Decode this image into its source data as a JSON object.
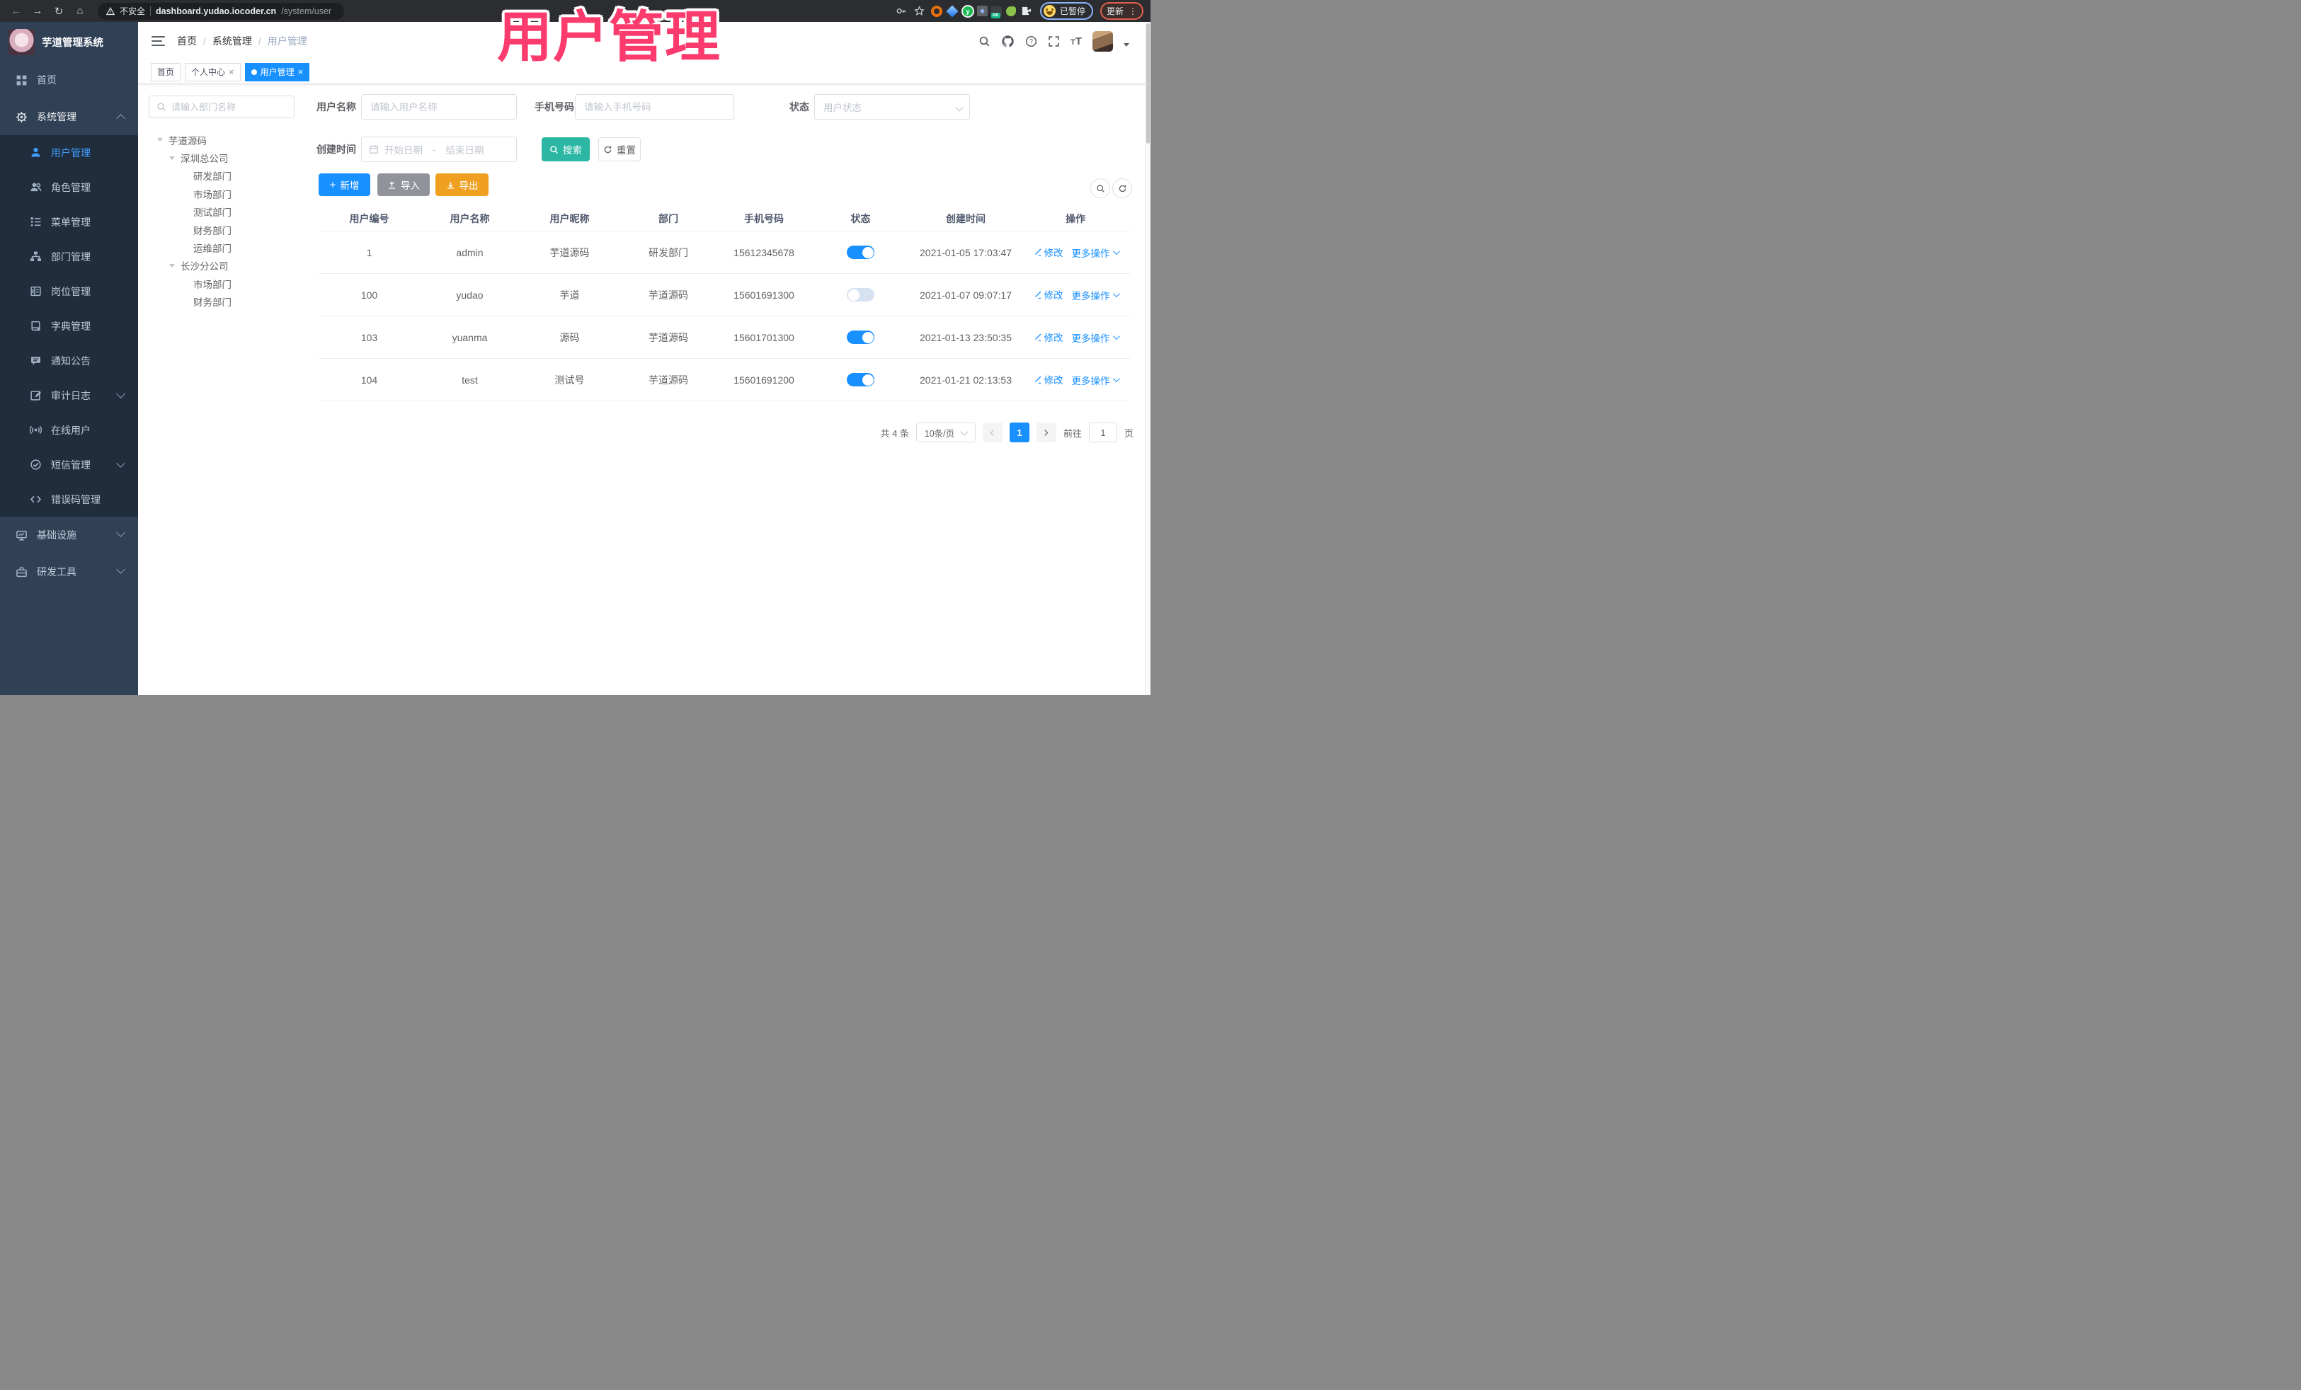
{
  "colors": {
    "primary": "#1890ff",
    "sidebar_active": "#409EFF",
    "search_teal": "#2bb7a3",
    "export_orange": "#f0a020",
    "import_gray": "#909399",
    "annotation_pink": "#fb3a6d",
    "sidebar_bg": "#304156",
    "submenu_bg": "#1f2d3d"
  },
  "browser": {
    "security_label": "不安全",
    "url_domain": "dashboard.yudao.iocoder.cn",
    "url_path": "/system/user",
    "paused_badge": "已暂停",
    "update_label": "更新"
  },
  "annotation": {
    "text": "用户管理"
  },
  "sidebar": {
    "title": "芋道管理系统",
    "items": [
      {
        "label": "首页",
        "icon": "dashboard-icon",
        "level": "top"
      },
      {
        "label": "系统管理",
        "icon": "gear-icon",
        "level": "top",
        "caret": "up",
        "open": true
      },
      {
        "label": "用户管理",
        "icon": "user-icon",
        "level": "sub",
        "active": true
      },
      {
        "label": "角色管理",
        "icon": "role-icon",
        "level": "sub"
      },
      {
        "label": "菜单管理",
        "icon": "menu-tree-icon",
        "level": "sub"
      },
      {
        "label": "部门管理",
        "icon": "dept-tree-icon",
        "level": "sub"
      },
      {
        "label": "岗位管理",
        "icon": "post-icon",
        "level": "sub"
      },
      {
        "label": "字典管理",
        "icon": "dict-icon",
        "level": "sub"
      },
      {
        "label": "通知公告",
        "icon": "notice-icon",
        "level": "sub"
      },
      {
        "label": "审计日志",
        "icon": "audit-icon",
        "level": "sub",
        "caret": "down"
      },
      {
        "label": "在线用户",
        "icon": "online-icon",
        "level": "sub"
      },
      {
        "label": "短信管理",
        "icon": "sms-icon",
        "level": "sub",
        "caret": "down"
      },
      {
        "label": "错误码管理",
        "icon": "errcode-icon",
        "level": "sub"
      },
      {
        "label": "基础设施",
        "icon": "infra-icon",
        "level": "top",
        "caret": "down"
      },
      {
        "label": "研发工具",
        "icon": "devtools-icon",
        "level": "top",
        "caret": "down"
      }
    ]
  },
  "header": {
    "breadcrumb": [
      "首页",
      "系统管理",
      "用户管理"
    ]
  },
  "tabs": [
    {
      "label": "首页",
      "closable": false,
      "active": false
    },
    {
      "label": "个人中心",
      "closable": true,
      "active": false
    },
    {
      "label": "用户管理",
      "closable": true,
      "active": true
    }
  ],
  "dept_panel": {
    "search_placeholder": "请输入部门名称",
    "tree": [
      {
        "label": "芋道源码",
        "level": 0,
        "expandable": true
      },
      {
        "label": "深圳总公司",
        "level": 1,
        "expandable": true
      },
      {
        "label": "研发部门",
        "level": 2,
        "expandable": false
      },
      {
        "label": "市场部门",
        "level": 2,
        "expandable": false
      },
      {
        "label": "测试部门",
        "level": 2,
        "expandable": false
      },
      {
        "label": "财务部门",
        "level": 2,
        "expandable": false
      },
      {
        "label": "运维部门",
        "level": 2,
        "expandable": false
      },
      {
        "label": "长沙分公司",
        "level": 1,
        "expandable": true
      },
      {
        "label": "市场部门",
        "level": 2,
        "expandable": false
      },
      {
        "label": "财务部门",
        "level": 2,
        "expandable": false
      }
    ]
  },
  "filters": {
    "username_label": "用户名称",
    "username_placeholder": "请输入用户名称",
    "mobile_label": "手机号码",
    "mobile_placeholder": "请输入手机号码",
    "status_label": "状态",
    "status_placeholder": "用户状态",
    "created_label": "创建时间",
    "date_start_placeholder": "开始日期",
    "date_separator": "-",
    "date_end_placeholder": "结束日期",
    "search_button": "搜索",
    "reset_button": "重置"
  },
  "toolbar": {
    "add_button": "新增",
    "import_button": "导入",
    "export_button": "导出"
  },
  "table": {
    "columns": [
      "用户编号",
      "用户名称",
      "用户昵称",
      "部门",
      "手机号码",
      "状态",
      "创建时间",
      "操作"
    ],
    "row_actions": {
      "edit": "修改",
      "more": "更多操作"
    },
    "rows": [
      {
        "id": "1",
        "username": "admin",
        "nickname": "芋道源码",
        "dept": "研发部门",
        "mobile": "15612345678",
        "status_on": true,
        "created": "2021-01-05 17:03:47"
      },
      {
        "id": "100",
        "username": "yudao",
        "nickname": "芋道",
        "dept": "芋道源码",
        "mobile": "15601691300",
        "status_on": false,
        "created": "2021-01-07 09:07:17"
      },
      {
        "id": "103",
        "username": "yuanma",
        "nickname": "源码",
        "dept": "芋道源码",
        "mobile": "15601701300",
        "status_on": true,
        "created": "2021-01-13 23:50:35"
      },
      {
        "id": "104",
        "username": "test",
        "nickname": "测试号",
        "dept": "芋道源码",
        "mobile": "15601691200",
        "status_on": true,
        "created": "2021-01-21 02:13:53"
      }
    ]
  },
  "pagination": {
    "total_text": "共 4 条",
    "page_size": "10条/页",
    "current_page": "1",
    "goto_label": "前往",
    "goto_value": "1",
    "page_unit": "页"
  }
}
